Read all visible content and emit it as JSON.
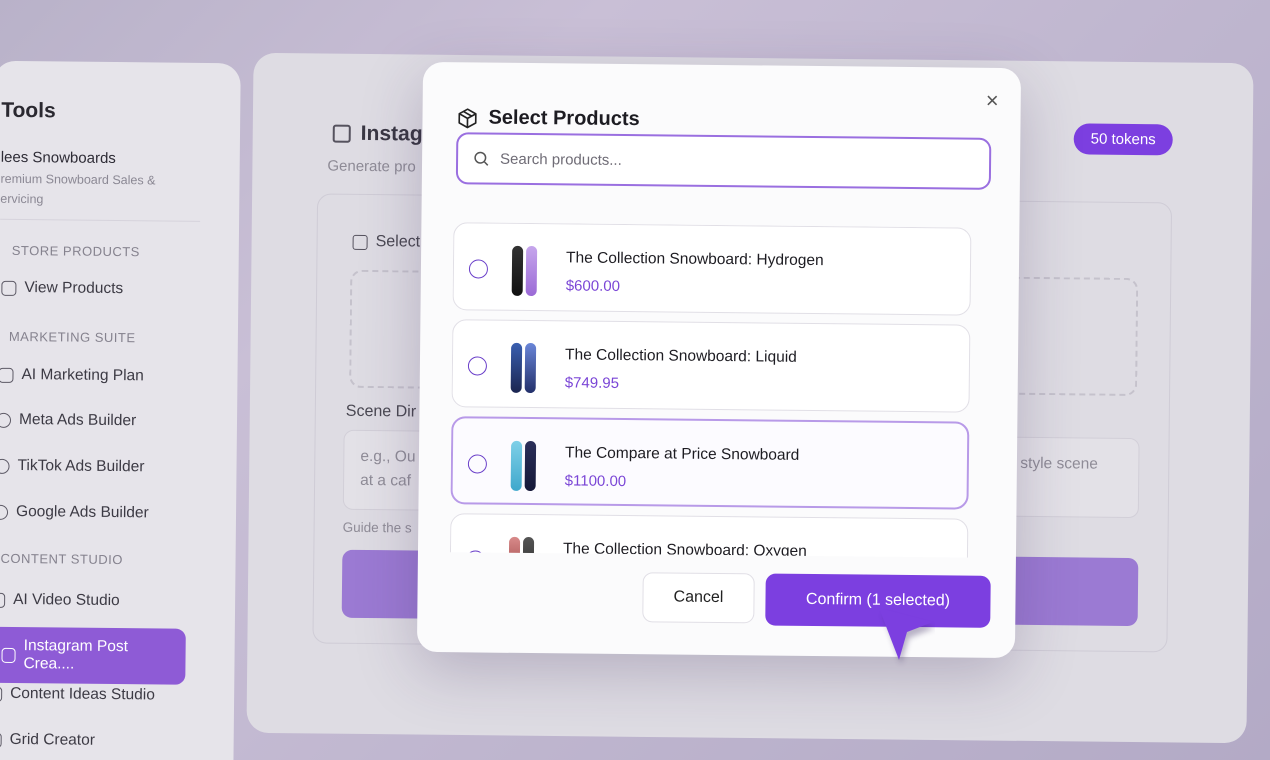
{
  "sidebar": {
    "title": "Tools",
    "store_name": "lees Snowboards",
    "store_tagline": "remium Snowboard Sales & ervicing",
    "sections": {
      "store_products": "STORE PRODUCTS",
      "marketing_suite": "MARKETING SUITE",
      "content_studio": "CONTENT STUDIO"
    },
    "items": {
      "view_products": "View Products",
      "ai_marketing_plan": "AI Marketing Plan",
      "meta_ads": "Meta Ads Builder",
      "tiktok_ads": "TikTok Ads Builder",
      "google_ads": "Google Ads Builder",
      "ai_video": "AI Video Studio",
      "instagram": "Instagram Post Crea....",
      "content_ideas": "Content Ideas Studio",
      "grid_creator": "Grid Creator"
    }
  },
  "main": {
    "title": "Instagr",
    "subtitle": "Generate pro",
    "tokens": "50 tokens",
    "select_label": "Select",
    "scene_label": "Scene Dir",
    "scene_placeholder_left": "e.g., Ou at a caf",
    "scene_placeholder_right": "style scene",
    "guide": "Guide the s"
  },
  "modal": {
    "title": "Select Products",
    "close": "×",
    "search_placeholder": "Search products...",
    "products": [
      {
        "name": "The Collection Snowboard: Hydrogen",
        "price": "$600.00",
        "selected": false
      },
      {
        "name": "The Collection Snowboard: Liquid",
        "price": "$749.95",
        "selected": false
      },
      {
        "name": "The Compare at Price Snowboard",
        "price": "$1100.00",
        "selected": true
      },
      {
        "name": "The Collection Snowboard: Oxygen",
        "price": "",
        "selected": false
      }
    ],
    "cancel_label": "Cancel",
    "confirm_label": "Confirm (1 selected)"
  },
  "colors": {
    "accent": "#7c3fe0",
    "price": "#7a45d6"
  }
}
